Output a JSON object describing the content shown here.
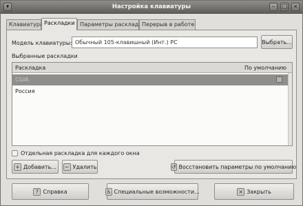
{
  "window": {
    "title": "Настройка клавиатуры"
  },
  "tabs": [
    {
      "label": "Клавиатура",
      "active": false
    },
    {
      "label": "Раскладки",
      "active": true
    },
    {
      "label": "Параметры раскладки",
      "active": false
    },
    {
      "label": "Перерыв в работе",
      "active": false
    }
  ],
  "model": {
    "label": "Модель клавиатуры:",
    "value": "Обычный 105-клавишный (Инт.) PC",
    "choose_label": "Выбрать..."
  },
  "layouts": {
    "section_label": "Выбранные раскладки",
    "columns": [
      "Раскладка",
      "По умолчанию"
    ],
    "rows": [
      {
        "name": "США",
        "default": true,
        "selected": true
      },
      {
        "name": "Россия",
        "default": false,
        "selected": false
      }
    ]
  },
  "separate_layout": {
    "label": "Отдельная раскладка для каждого окна",
    "checked": false
  },
  "buttons": {
    "add": "Добавить...",
    "remove": "Удалить",
    "restore": "Восстановить параметры по умолчанию",
    "help": "Справка",
    "accessibility": "Специальные возможности...",
    "close": "Закрыть"
  },
  "icons": {
    "add": "plus-icon",
    "remove": "minus-icon",
    "restore": "restore-icon",
    "help": "help-icon",
    "accessibility": "accessibility-icon",
    "close": "close-icon"
  }
}
